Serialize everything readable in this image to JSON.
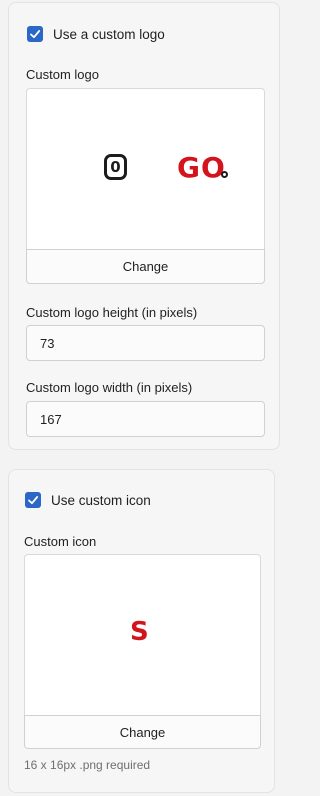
{
  "logo_section": {
    "checkbox_label": "Use a custom logo",
    "checked": true,
    "preview_label": "Custom logo",
    "logo_text_left": "0",
    "logo_text_right": "GO",
    "change_label": "Change",
    "height_label": "Custom logo height (in pixels)",
    "height_value": "73",
    "width_label": "Custom logo width (in pixels)",
    "width_value": "167"
  },
  "icon_section": {
    "checkbox_label": "Use custom icon",
    "checked": true,
    "preview_label": "Custom icon",
    "icon_text": "S",
    "change_label": "Change",
    "hint": "16 x 16px .png required"
  },
  "colors": {
    "accent": "#2b67c6",
    "logo_red": "#d3141c",
    "logo_dark": "#1c1c1c"
  }
}
